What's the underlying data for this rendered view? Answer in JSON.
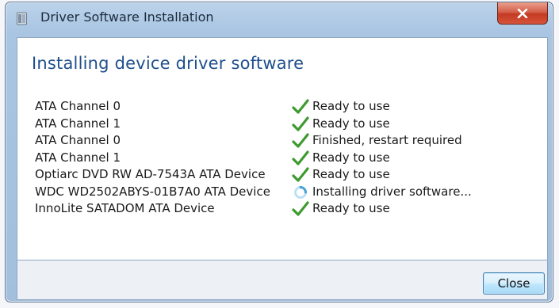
{
  "window": {
    "title": "Driver Software Installation",
    "close_glyph": "x"
  },
  "main": {
    "heading": "Installing device driver software",
    "devices": [
      {
        "name": "ATA Channel 0",
        "status": "Ready to use",
        "icon": "check-icon"
      },
      {
        "name": "ATA Channel 1",
        "status": "Ready to use",
        "icon": "check-icon"
      },
      {
        "name": "ATA Channel 0",
        "status": "Finished, restart required",
        "icon": "check-icon"
      },
      {
        "name": "ATA Channel 1",
        "status": "Ready to use",
        "icon": "check-icon"
      },
      {
        "name": "Optiarc DVD RW AD-7543A ATA Device",
        "status": "Ready to use",
        "icon": "check-icon"
      },
      {
        "name": "WDC WD2502ABYS-01B7A0 ATA Device",
        "status": "Installing driver software...",
        "icon": "busy-spinner-icon"
      },
      {
        "name": "InnoLite SATADOM ATA Device",
        "status": "Ready to use",
        "icon": "check-icon"
      }
    ]
  },
  "footer": {
    "close_label": "Close"
  },
  "colors": {
    "heading": "#1f4f8c",
    "check": "#3d9a2e",
    "title_close": "#c33a22"
  }
}
